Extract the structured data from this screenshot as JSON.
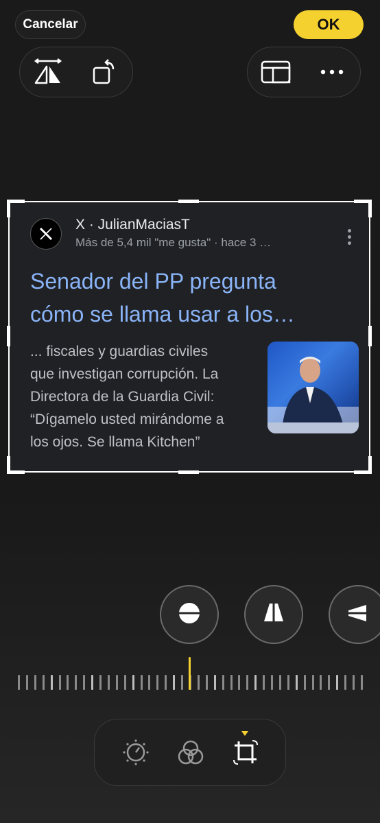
{
  "top_bar": {
    "cancel_label": "Cancelar",
    "ok_label": "OK"
  },
  "toolbar": {
    "left": [
      "flip-horizontal-icon",
      "rotate-icon"
    ],
    "right": [
      "aspect-ratio-icon",
      "more-icon"
    ]
  },
  "card": {
    "source": "X · JulianMaciasT",
    "meta": "Más de 5,4 mil \"me gusta\" · hace 3 …",
    "headline_line1": "Senador del PP pregunta",
    "headline_line2": "cómo se llama usar a los…",
    "snippet_lines": [
      "... fiscales y guardias civiles",
      "que investigan corrupción. La",
      "Directora de la Guardia Civil:",
      "“Dígamelo usted mirándome a",
      "los ojos. Se llama Kitchen”"
    ]
  },
  "adjust_controls": [
    "straighten-icon",
    "vertical-perspective-icon",
    "horizontal-perspective-icon"
  ],
  "bottom_tools": [
    "adjust-icon",
    "filters-icon",
    "crop-icon"
  ],
  "colors": {
    "accent": "#f5d130",
    "link": "#8ab4f8"
  }
}
